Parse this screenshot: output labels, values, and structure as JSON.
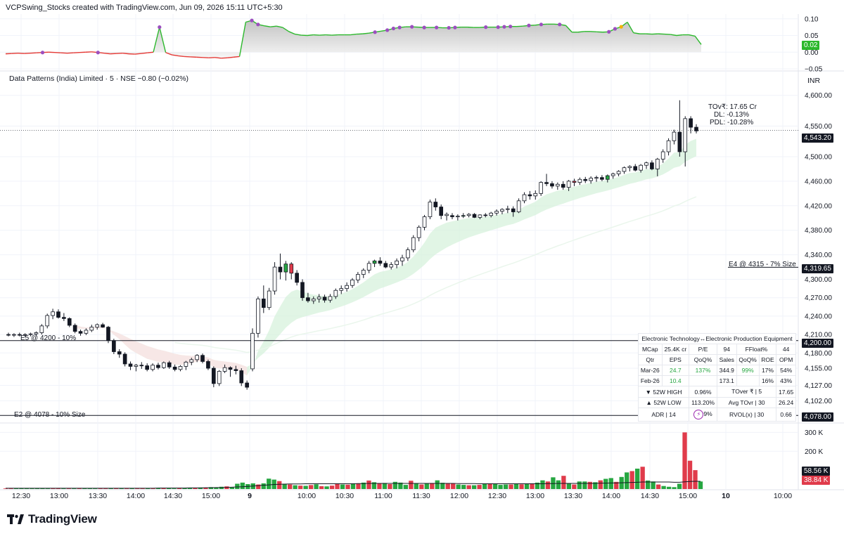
{
  "header": {
    "watermark": "VCPSwing_Stocks created with TradingView.com, Jun 09, 2026 15:11 UTC+5:30",
    "symbol_line": "Data Patterns (India) Limited · 5 · NSE  −0.80 (−0.02%)",
    "currency": "INR"
  },
  "colors": {
    "up": "#26a641",
    "down": "#e03b4b",
    "hollow_up": "#ffffff",
    "black": "#131722",
    "osc_pos": "#2cb82c",
    "osc_neg": "#e53935",
    "dot": "#9c4fbf",
    "dot_gold": "#f0b400",
    "ema_band": "#d7f2dc",
    "ma_line": "#f3c7c9"
  },
  "oscillator": {
    "axis_ticks": [
      "0.10",
      "0.05",
      "0.00",
      "−0.05"
    ],
    "current": "0.02",
    "values": [
      -0.005,
      -0.004,
      -0.003,
      -0.004,
      -0.003,
      -0.002,
      -0.001,
      0.0,
      -0.001,
      -0.002,
      -0.003,
      -0.002,
      -0.001,
      0.0,
      0.001,
      -0.001,
      -0.003,
      -0.005,
      -0.004,
      -0.003,
      -0.005,
      -0.006,
      -0.004,
      -0.002,
      0.0,
      0.075,
      -0.001,
      -0.008,
      -0.011,
      -0.013,
      -0.014,
      -0.015,
      -0.016,
      -0.017,
      -0.016,
      -0.018,
      -0.017,
      -0.015,
      -0.013,
      0.09,
      0.095,
      0.083,
      0.079,
      0.076,
      0.078,
      0.074,
      0.062,
      0.054,
      0.051,
      0.05,
      0.052,
      0.051,
      0.052,
      0.051,
      0.052,
      0.052,
      0.052,
      0.054,
      0.055,
      0.057,
      0.06,
      0.063,
      0.066,
      0.071,
      0.074,
      0.076,
      0.076,
      0.075,
      0.074,
      0.074,
      0.074,
      0.073,
      0.073,
      0.074,
      0.075,
      0.075,
      0.074,
      0.074,
      0.075,
      0.075,
      0.075,
      0.076,
      0.077,
      0.077,
      0.078,
      0.08,
      0.081,
      0.083,
      0.084,
      0.084,
      0.083,
      0.08,
      0.06,
      0.06,
      0.062,
      0.062,
      0.061,
      0.06,
      0.061,
      0.07,
      0.076,
      0.09,
      0.058,
      0.055,
      0.055,
      0.054,
      0.055,
      0.054,
      0.053,
      0.05,
      0.052,
      0.052,
      0.048,
      0.023
    ],
    "dot_indices": [
      6,
      15,
      25,
      40,
      41,
      60,
      62,
      63,
      64,
      66,
      68,
      70,
      72,
      73,
      78,
      80,
      81,
      82,
      85,
      87,
      90,
      98,
      99
    ],
    "gold_index": 100
  },
  "price_axis": {
    "ticks": [
      "4,600.00",
      "4,550.00",
      "4,500.00",
      "4,460.00",
      "4,420.00",
      "4,380.00",
      "4,340.00",
      "4,300.00",
      "4,270.00",
      "4,240.00",
      "4,210.00",
      "4,180.00",
      "4,155.00",
      "4,127.00",
      "4,102.00"
    ],
    "tick_values": [
      4600,
      4550,
      4500,
      4460,
      4420,
      4380,
      4340,
      4300,
      4270,
      4240,
      4210,
      4180,
      4155,
      4127,
      4102
    ],
    "current_price": "4,543.20",
    "level_e4_price": "4,319.65",
    "level_e5_price": "4,200.00",
    "level_e2_price": "4,078.00"
  },
  "levels": {
    "e4": "E4  @ 4315 - 7% Size",
    "e5": "E5 @ 4200 - 10%",
    "e2": "E2 @ 4078 - 10% Size"
  },
  "stats_box": {
    "tovr": "TOv₹: 17.65 Cr",
    "dl": "DL: -0.13%",
    "pdl": "PDL: -10.28%"
  },
  "fundamentals": {
    "sector": "Electronic Technology↔Electronic Production Equipment",
    "rows": [
      [
        "MCap",
        "25.4K cr",
        "P/E",
        "94",
        "FFloat%",
        "44"
      ],
      [
        "Qtr",
        "EPS",
        "QoQ%",
        "Sales",
        "QoQ%",
        "ROE",
        "OPM"
      ],
      [
        "Mar-26",
        "24.7",
        "137%",
        "344.9",
        "99%",
        "17%",
        "54%"
      ],
      [
        "Feb-26",
        "10.4",
        "",
        "173.1",
        "",
        "16%",
        "43%"
      ],
      [
        "▼ 52W HIGH",
        "0.96%",
        "TOver ₹ | 5",
        "17.65"
      ],
      [
        "▲ 52W LOW",
        "113.20%",
        "Avg TOvr | 30",
        "26.24"
      ],
      [
        "ADR | 14",
        "",
        "RVOL(x) | 30",
        "0.66"
      ]
    ],
    "adr_value_partial": "9%"
  },
  "volume": {
    "axis_ticks": [
      "300 K",
      "200 K"
    ],
    "badge_top": "58.56 K",
    "badge_bottom": "38.84 K"
  },
  "time_axis": {
    "labels": [
      "12:30",
      "13:00",
      "13:30",
      "14:00",
      "14:30",
      "15:00",
      "9",
      "10:00",
      "10:30",
      "11:00",
      "11:30",
      "12:00",
      "12:30",
      "13:00",
      "13:30",
      "14:00",
      "14:30",
      "15:00",
      "10",
      "10:00"
    ],
    "bold_labels": [
      "9",
      "10"
    ]
  },
  "footer": {
    "brand": "TradingView"
  },
  "chart_data": {
    "type": "candlestick",
    "title": "Data Patterns (India) Limited · 5 · NSE",
    "ylim": [
      4068,
      4618
    ],
    "candles": [
      [
        4210,
        4213,
        4207,
        4209
      ],
      [
        4209,
        4212,
        4206,
        4210
      ],
      [
        4210,
        4213,
        4207,
        4209
      ],
      [
        4209,
        4212,
        4206,
        4210
      ],
      [
        4210,
        4213,
        4207,
        4211
      ],
      [
        4211,
        4215,
        4208,
        4213
      ],
      [
        4213,
        4227,
        4210,
        4224
      ],
      [
        4224,
        4244,
        4220,
        4241
      ],
      [
        4241,
        4252,
        4235,
        4247
      ],
      [
        4247,
        4251,
        4236,
        4238
      ],
      [
        4238,
        4245,
        4232,
        4236
      ],
      [
        4236,
        4238,
        4222,
        4225
      ],
      [
        4225,
        4228,
        4212,
        4215
      ],
      [
        4215,
        4218,
        4208,
        4212
      ],
      [
        4212,
        4220,
        4209,
        4217
      ],
      [
        4217,
        4226,
        4214,
        4222
      ],
      [
        4222,
        4228,
        4218,
        4226
      ],
      [
        4226,
        4229,
        4221,
        4222
      ],
      [
        4222,
        4224,
        4196,
        4200
      ],
      [
        4200,
        4203,
        4178,
        4182
      ],
      [
        4182,
        4186,
        4172,
        4178
      ],
      [
        4178,
        4181,
        4158,
        4162
      ],
      [
        4162,
        4166,
        4152,
        4158
      ],
      [
        4158,
        4162,
        4150,
        4160
      ],
      [
        4160,
        4165,
        4154,
        4159
      ],
      [
        4159,
        4163,
        4150,
        4153
      ],
      [
        4153,
        4163,
        4150,
        4160
      ],
      [
        4160,
        4164,
        4153,
        4156
      ],
      [
        4156,
        4166,
        4154,
        4164
      ],
      [
        4164,
        4167,
        4154,
        4157
      ],
      [
        4157,
        4161,
        4150,
        4153
      ],
      [
        4153,
        4160,
        4150,
        4158
      ],
      [
        4158,
        4167,
        4152,
        4165
      ],
      [
        4165,
        4172,
        4160,
        4169
      ],
      [
        4169,
        4178,
        4165,
        4176
      ],
      [
        4176,
        4179,
        4163,
        4166
      ],
      [
        4166,
        4169,
        4152,
        4155
      ],
      [
        4155,
        4158,
        4124,
        4130
      ],
      [
        4130,
        4152,
        4126,
        4150
      ],
      [
        4150,
        4161,
        4147,
        4156
      ],
      [
        4156,
        4158,
        4141,
        4153
      ],
      [
        4153,
        4159,
        4145,
        4151
      ],
      [
        4151,
        4155,
        4126,
        4131
      ],
      [
        4131,
        4135,
        4120,
        4124
      ],
      [
        4154,
        4220,
        4150,
        4212
      ],
      [
        4212,
        4272,
        4205,
        4268
      ],
      [
        4268,
        4290,
        4245,
        4254
      ],
      [
        4254,
        4286,
        4250,
        4281
      ],
      [
        4281,
        4328,
        4275,
        4320
      ],
      [
        4320,
        4342,
        4300,
        4312
      ],
      [
        4312,
        4330,
        4298,
        4325
      ],
      [
        4325,
        4328,
        4300,
        4310
      ],
      [
        4310,
        4315,
        4290,
        4295
      ],
      [
        4295,
        4300,
        4265,
        4270
      ],
      [
        4270,
        4278,
        4262,
        4265
      ],
      [
        4265,
        4272,
        4260,
        4268
      ],
      [
        4268,
        4276,
        4262,
        4271
      ],
      [
        4271,
        4275,
        4262,
        4266
      ],
      [
        4266,
        4276,
        4262,
        4272
      ],
      [
        4272,
        4285,
        4268,
        4282
      ],
      [
        4282,
        4290,
        4276,
        4285
      ],
      [
        4285,
        4295,
        4280,
        4290
      ],
      [
        4290,
        4302,
        4286,
        4299
      ],
      [
        4299,
        4312,
        4294,
        4308
      ],
      [
        4308,
        4318,
        4302,
        4315
      ],
      [
        4315,
        4330,
        4310,
        4326
      ],
      [
        4326,
        4332,
        4320,
        4330
      ],
      [
        4330,
        4336,
        4322,
        4326
      ],
      [
        4326,
        4330,
        4318,
        4320
      ],
      [
        4320,
        4328,
        4316,
        4324
      ],
      [
        4324,
        4334,
        4318,
        4330
      ],
      [
        4330,
        4340,
        4322,
        4335
      ],
      [
        4335,
        4352,
        4330,
        4348
      ],
      [
        4348,
        4372,
        4344,
        4368
      ],
      [
        4368,
        4388,
        4362,
        4385
      ],
      [
        4385,
        4405,
        4380,
        4402
      ],
      [
        4402,
        4430,
        4398,
        4426
      ],
      [
        4426,
        4432,
        4412,
        4418
      ],
      [
        4418,
        4422,
        4398,
        4404
      ],
      [
        4404,
        4409,
        4396,
        4406
      ],
      [
        4404,
        4408,
        4398,
        4402
      ],
      [
        4402,
        4406,
        4396,
        4403
      ],
      [
        4403,
        4408,
        4400,
        4404
      ],
      [
        4404,
        4408,
        4401,
        4406
      ],
      [
        4406,
        4408,
        4400,
        4401
      ],
      [
        4401,
        4406,
        4398,
        4405
      ],
      [
        4405,
        4408,
        4401,
        4404
      ],
      [
        4404,
        4410,
        4401,
        4408
      ],
      [
        4408,
        4414,
        4404,
        4411
      ],
      [
        4411,
        4416,
        4406,
        4414
      ],
      [
        4414,
        4420,
        4408,
        4415
      ],
      [
        4415,
        4419,
        4402,
        4410
      ],
      [
        4410,
        4432,
        4408,
        4428
      ],
      [
        4428,
        4442,
        4424,
        4438
      ],
      [
        4438,
        4444,
        4430,
        4436
      ],
      [
        4436,
        4445,
        4430,
        4440
      ],
      [
        4440,
        4460,
        4436,
        4458
      ],
      [
        4458,
        4472,
        4452,
        4456
      ],
      [
        4456,
        4460,
        4448,
        4452
      ],
      [
        4452,
        4458,
        4446,
        4455
      ],
      [
        4455,
        4460,
        4446,
        4450
      ],
      [
        4450,
        4462,
        4444,
        4460
      ],
      [
        4460,
        4464,
        4452,
        4458
      ],
      [
        4458,
        4466,
        4454,
        4463
      ],
      [
        4463,
        4467,
        4457,
        4461
      ],
      [
        4461,
        4468,
        4456,
        4465
      ],
      [
        4465,
        4469,
        4459,
        4466
      ],
      [
        4466,
        4470,
        4460,
        4463
      ],
      [
        4463,
        4471,
        4458,
        4469
      ],
      [
        4469,
        4474,
        4464,
        4472
      ],
      [
        4472,
        4478,
        4468,
        4476
      ],
      [
        4476,
        4484,
        4472,
        4482
      ],
      [
        4482,
        4486,
        4476,
        4484
      ],
      [
        4484,
        4488,
        4476,
        4478
      ],
      [
        4478,
        4488,
        4474,
        4486
      ],
      [
        4486,
        4492,
        4480,
        4490
      ],
      [
        4490,
        4494,
        4478,
        4480
      ],
      [
        4480,
        4498,
        4468,
        4496
      ],
      [
        4496,
        4512,
        4490,
        4508
      ],
      [
        4508,
        4530,
        4502,
        4526
      ],
      [
        4526,
        4544,
        4520,
        4540
      ],
      [
        4540,
        4592,
        4500,
        4508
      ],
      [
        4508,
        4566,
        4484,
        4562
      ],
      [
        4562,
        4566,
        4538,
        4548
      ],
      [
        4548,
        4553,
        4538,
        4542
      ]
    ],
    "colored_candles": {
      "green": [
        40,
        50,
        66,
        82,
        97,
        102,
        108
      ],
      "red": [
        26,
        51,
        56,
        79,
        85,
        99,
        102
      ]
    },
    "volume_values": [
      3,
      3,
      4,
      4,
      4,
      3,
      4,
      4,
      3,
      3,
      4,
      3,
      3,
      3,
      4,
      5,
      4,
      3,
      3,
      3,
      4,
      5,
      4,
      3,
      4,
      3,
      3,
      4,
      3,
      5,
      4,
      4,
      3,
      4,
      5,
      6,
      5,
      8,
      6,
      10,
      8,
      12,
      14,
      9,
      28,
      34,
      26,
      30,
      24,
      30,
      55,
      50,
      42,
      28,
      24,
      20,
      18,
      17,
      21,
      25,
      15,
      14,
      18,
      30,
      24,
      23,
      30,
      30,
      34,
      45,
      36,
      30,
      32,
      26,
      38,
      34,
      22,
      44,
      28,
      24,
      28,
      32,
      46,
      33,
      30,
      28,
      24,
      22,
      20,
      20,
      22,
      28,
      26,
      26,
      22,
      24,
      24,
      26,
      25,
      28,
      30,
      34,
      46,
      40,
      62,
      46,
      70,
      30,
      24,
      40,
      40,
      38,
      36,
      46,
      54,
      58,
      38,
      64,
      88,
      95,
      108,
      118,
      45,
      40,
      24,
      16,
      12,
      10,
      28,
      300,
      150,
      100,
      40
    ],
    "volume_red": [
      0,
      1,
      9,
      10,
      12,
      14,
      18,
      19,
      21,
      23,
      25,
      26,
      28,
      30,
      33,
      36,
      38,
      42,
      48,
      52,
      54,
      56,
      58,
      60,
      62,
      63,
      65,
      67,
      69,
      71,
      73,
      77,
      79,
      81,
      84,
      85,
      88,
      90,
      92,
      96,
      98,
      100,
      103,
      106,
      108,
      111,
      113,
      116,
      119,
      121,
      124,
      129,
      130,
      131
    ],
    "volume_ma": [
      4,
      4,
      4,
      4,
      4,
      4,
      4,
      4,
      4,
      4,
      4,
      4,
      4,
      4,
      4,
      4,
      4,
      4,
      4,
      4,
      4,
      4,
      4,
      4,
      4,
      4,
      4,
      4,
      4,
      5,
      5,
      5,
      5,
      5,
      5,
      6,
      6,
      6,
      7,
      7,
      8,
      8,
      9,
      10,
      11,
      12,
      14,
      16,
      18,
      20,
      22,
      24,
      25,
      26,
      27,
      27,
      27,
      28,
      28,
      28,
      28,
      28,
      28,
      28,
      28,
      28,
      28,
      29,
      29,
      30,
      30,
      30,
      30,
      30,
      30,
      30,
      30,
      30,
      30,
      30,
      30,
      30,
      30,
      30,
      30,
      30,
      29,
      29,
      29,
      29,
      28,
      28,
      28,
      28,
      28,
      28,
      28,
      28,
      28,
      28,
      28,
      28,
      28,
      29,
      29,
      30,
      30,
      30,
      30,
      30,
      30,
      30,
      30,
      31,
      31,
      32,
      32,
      33,
      34,
      35,
      36,
      37,
      37,
      37,
      37,
      37,
      37,
      36,
      36,
      38,
      40,
      41,
      41
    ]
  }
}
